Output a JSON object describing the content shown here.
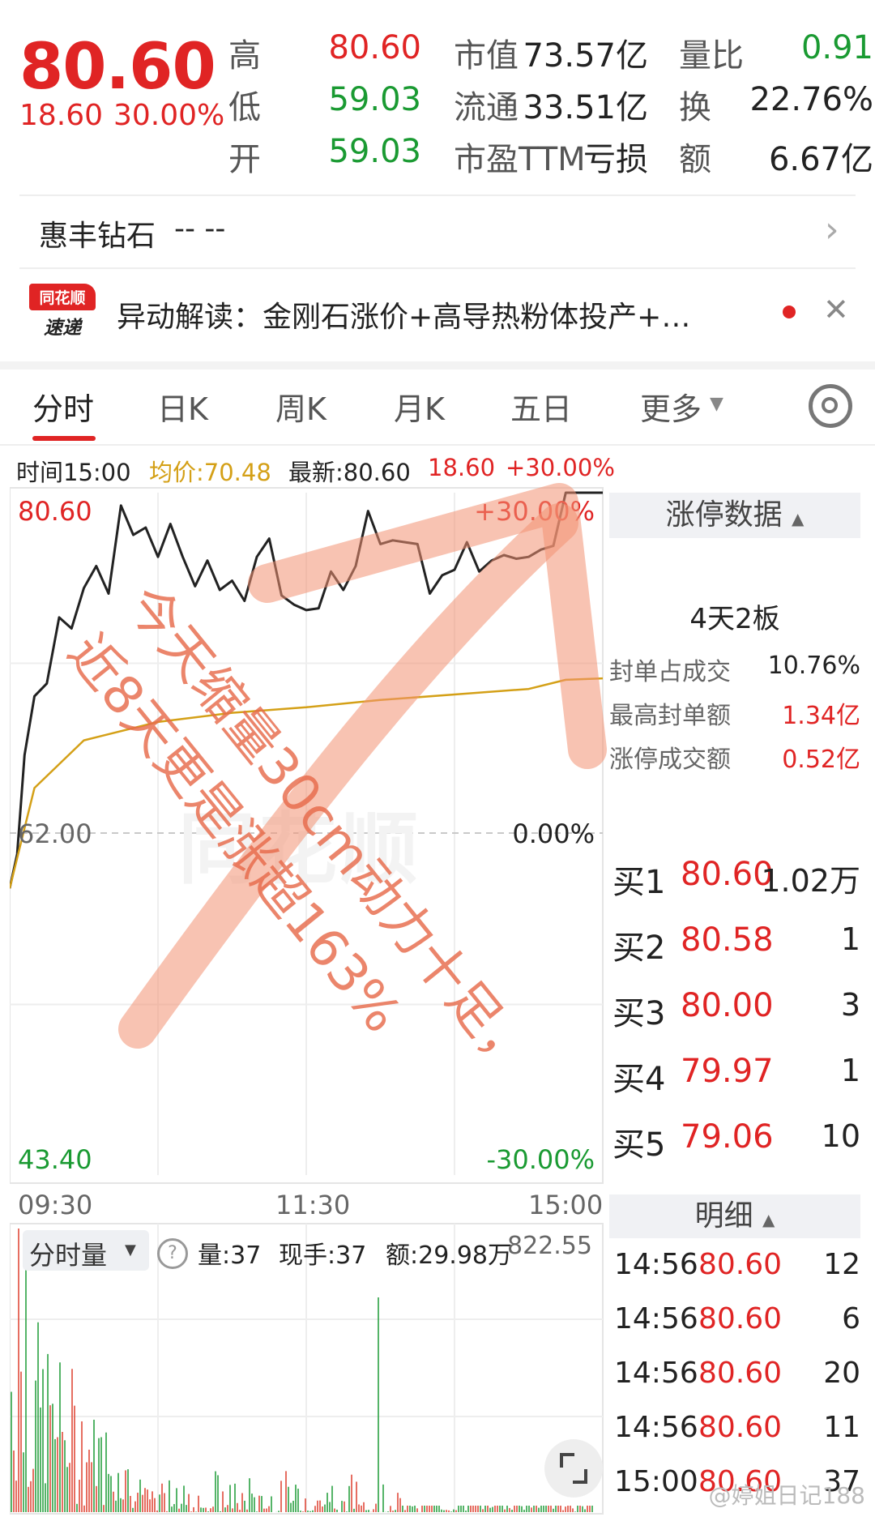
{
  "quote": {
    "price": "80.60",
    "change": "18.60",
    "change_pct": "30.00%",
    "rows": [
      {
        "l1": "高",
        "v1": "80.60",
        "l2": "市值",
        "v2": "73.57亿",
        "l3": "量比",
        "v3": "0.91"
      },
      {
        "l1": "低",
        "v1": "59.03",
        "l2": "流通",
        "v2": "33.51亿",
        "l3": "换",
        "v3": "22.76%"
      },
      {
        "l1": "开",
        "v1": "59.03",
        "l2": "市盈TTM",
        "v2": "亏损",
        "l3": "额",
        "v3": "6.67亿"
      }
    ]
  },
  "related": {
    "name": "惠丰钻石",
    "value": "-- --"
  },
  "news": {
    "logo_top": "同花顺",
    "logo_bottom": "速递",
    "text": "异动解读：金刚石涨价+高导热粉体投产+…"
  },
  "tabs": [
    "分时",
    "日K",
    "周K",
    "月K",
    "五日",
    "更多"
  ],
  "chart_info": {
    "time_label": "时间15:00",
    "avg_label": "均价:70.48",
    "latest_label": "最新:80.60",
    "change": "18.60",
    "change_pct": "+30.00%"
  },
  "axis": {
    "y_top": "80.60",
    "y_mid": "62.00",
    "y_bottom": "43.40",
    "pct_top": "+30.00%",
    "pct_mid": "0.00%",
    "pct_bottom": "-30.00%",
    "x_labels": [
      "09:30",
      "11:30",
      "15:00"
    ]
  },
  "limit_up": {
    "header": "涨停数据",
    "streak": "4天2板",
    "rows": [
      {
        "label": "封单占成交",
        "value": "10.76%"
      },
      {
        "label": "最高封单额",
        "value": "1.34亿"
      },
      {
        "label": "涨停成交额",
        "value": "0.52亿"
      }
    ]
  },
  "bids": [
    {
      "label": "买1",
      "price": "80.60",
      "vol": "1.02万"
    },
    {
      "label": "买2",
      "price": "80.58",
      "vol": "1"
    },
    {
      "label": "买3",
      "price": "80.00",
      "vol": "3"
    },
    {
      "label": "买4",
      "price": "79.97",
      "vol": "1"
    },
    {
      "label": "买5",
      "price": "79.06",
      "vol": "10"
    }
  ],
  "detail": {
    "header": "明细",
    "rows": [
      {
        "time": "14:56",
        "price": "80.60",
        "vol": "12"
      },
      {
        "time": "14:56",
        "price": "80.60",
        "vol": "6"
      },
      {
        "time": "14:56",
        "price": "80.60",
        "vol": "20"
      },
      {
        "time": "14:56",
        "price": "80.60",
        "vol": "11"
      },
      {
        "time": "15:00",
        "price": "80.60",
        "vol": "37"
      }
    ]
  },
  "volume": {
    "selector": "分时量",
    "amount": "量:37",
    "current": "现手:37",
    "turnover": "额:29.98万",
    "max": "822.55"
  },
  "annotation": {
    "line1": "今天缩量30cm动力十足，",
    "line2": "近8天更是涨超163%"
  },
  "watermark": "@婷姐日记188",
  "colors": {
    "up": "#e02424",
    "down": "#1a9a32",
    "avg": "#d4a017",
    "accent": "#f07a5a"
  },
  "chart_data": {
    "type": "line",
    "ylim": [
      43.4,
      80.6
    ],
    "series": [
      {
        "x": [
          "09:30",
          "09:33",
          "09:36",
          "09:40",
          "09:45",
          "09:50",
          "09:55",
          "10:00",
          "10:05",
          "10:10",
          "10:15",
          "10:20",
          "10:25",
          "10:30",
          "10:35",
          "10:40",
          "10:45",
          "10:50",
          "10:55",
          "11:00",
          "11:05",
          "11:10",
          "11:15",
          "11:20",
          "11:25",
          "11:30",
          "13:05",
          "13:10",
          "13:15",
          "13:20",
          "13:25",
          "13:30",
          "13:35",
          "13:40",
          "13:45",
          "13:50",
          "13:55",
          "14:00",
          "14:05",
          "14:10",
          "14:15",
          "14:20",
          "14:25",
          "14:30",
          "14:35",
          "14:40",
          "14:45",
          "14:50",
          "14:55",
          "15:00"
        ],
        "values": [
          59.03,
          60.9,
          66.3,
          69.5,
          70.2,
          73.8,
          73.2,
          75.4,
          76.6,
          75.1,
          79.9,
          78.3,
          78.7,
          77.1,
          78.9,
          77.1,
          75.5,
          76.9,
          75.3,
          75.8,
          74.7,
          77.1,
          78.1,
          75.0,
          74.5,
          74.2,
          74.3,
          76.3,
          75.3,
          76.6,
          79.6,
          77.8,
          78.0,
          77.9,
          77.8,
          75.1,
          76.1,
          76.4,
          77.9,
          76.3,
          76.9,
          77.2,
          77.0,
          77.1,
          77.5,
          77.7,
          80.6,
          80.6,
          80.6,
          80.6
        ]
      },
      {
        "x": [
          "09:30",
          "09:40",
          "10:00",
          "10:30",
          "11:00",
          "11:30",
          "13:30",
          "14:00",
          "14:30",
          "14:45",
          "15:00"
        ],
        "values": [
          59.03,
          64.5,
          67.1,
          68.1,
          68.6,
          68.9,
          69.3,
          69.6,
          69.9,
          70.4,
          70.48
        ]
      }
    ]
  }
}
